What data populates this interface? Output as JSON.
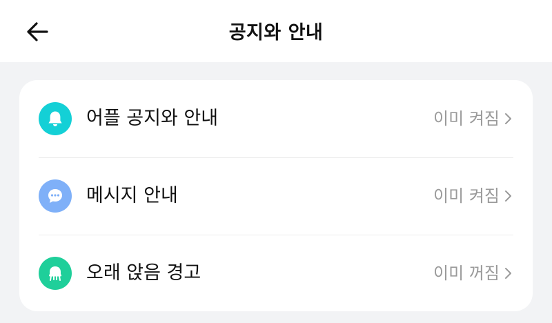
{
  "header": {
    "title": "공지와 안내",
    "back_icon": "arrow-left-icon"
  },
  "settings": {
    "items": [
      {
        "label": "어플 공지와 안내",
        "value": "이미 켜짐",
        "icon": "bell-icon",
        "icon_color": "#14d0d6"
      },
      {
        "label": "메시지 안내",
        "value": "이미 켜짐",
        "icon": "chat-bubble-icon",
        "icon_color": "#7fb0f8"
      },
      {
        "label": "오래 앉음 경고",
        "value": "이미 꺼짐",
        "icon": "chair-icon",
        "icon_color": "#1fcf9a"
      }
    ]
  },
  "colors": {
    "background": "#f2f3f5",
    "card": "#ffffff",
    "text_primary": "#111111",
    "text_secondary": "#9a9a9a"
  }
}
